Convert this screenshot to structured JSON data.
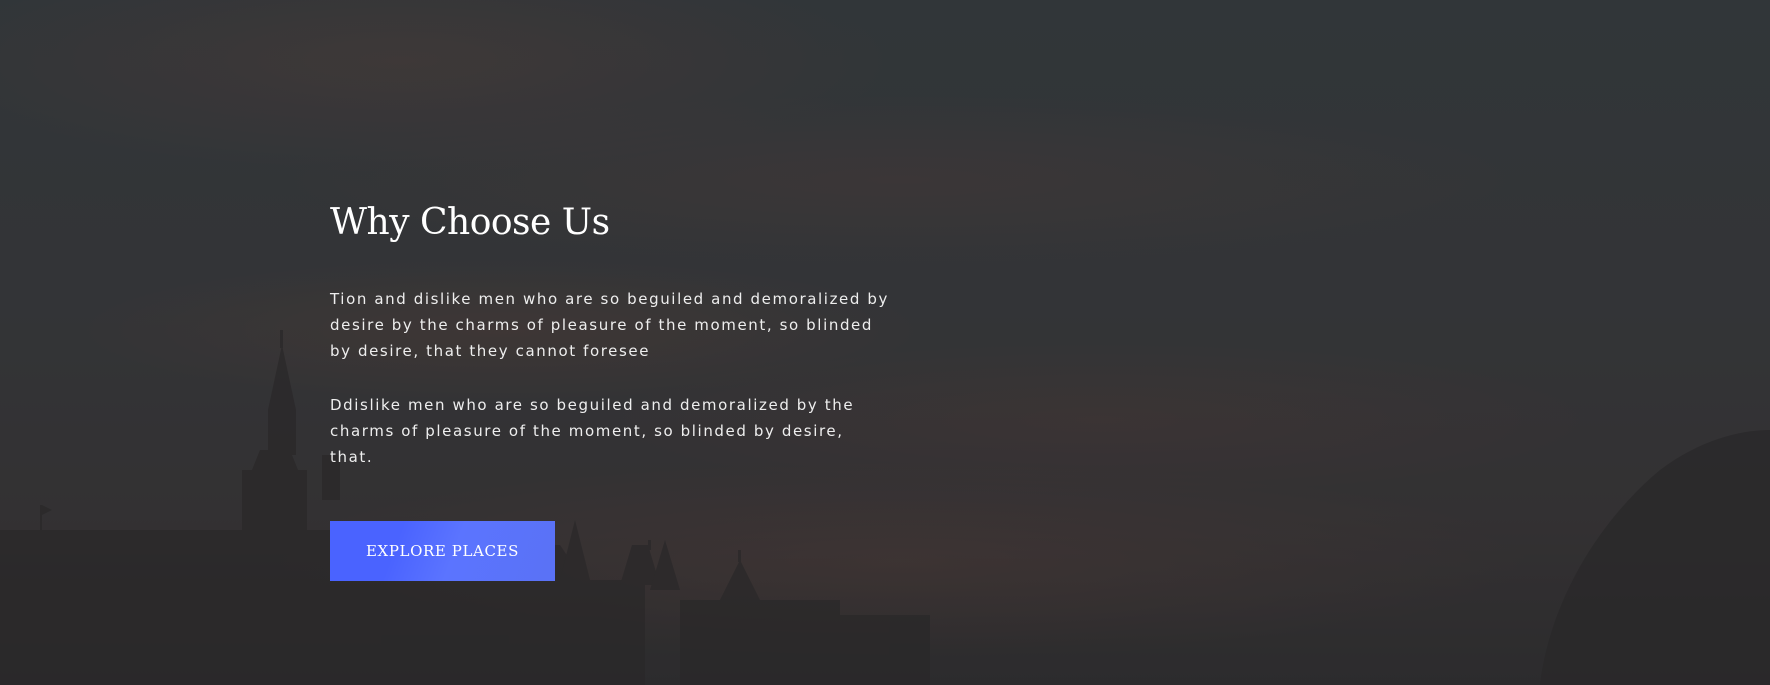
{
  "section": {
    "title": "Why Choose Us",
    "paragraph_1": "Tion and dislike men who are so beguiled and demoralized by desire by the charms of pleasure of the moment, so blinded by desire, that they cannot foresee",
    "paragraph_2": "Ddislike men who are so beguiled and demoralized by the charms of pleasure of the moment, so blinded by desire, that.",
    "button_label": "EXPLORE PLACES"
  },
  "colors": {
    "button_accent": "#4a63ff",
    "overlay": "#2f3335",
    "text": "#ffffff"
  }
}
